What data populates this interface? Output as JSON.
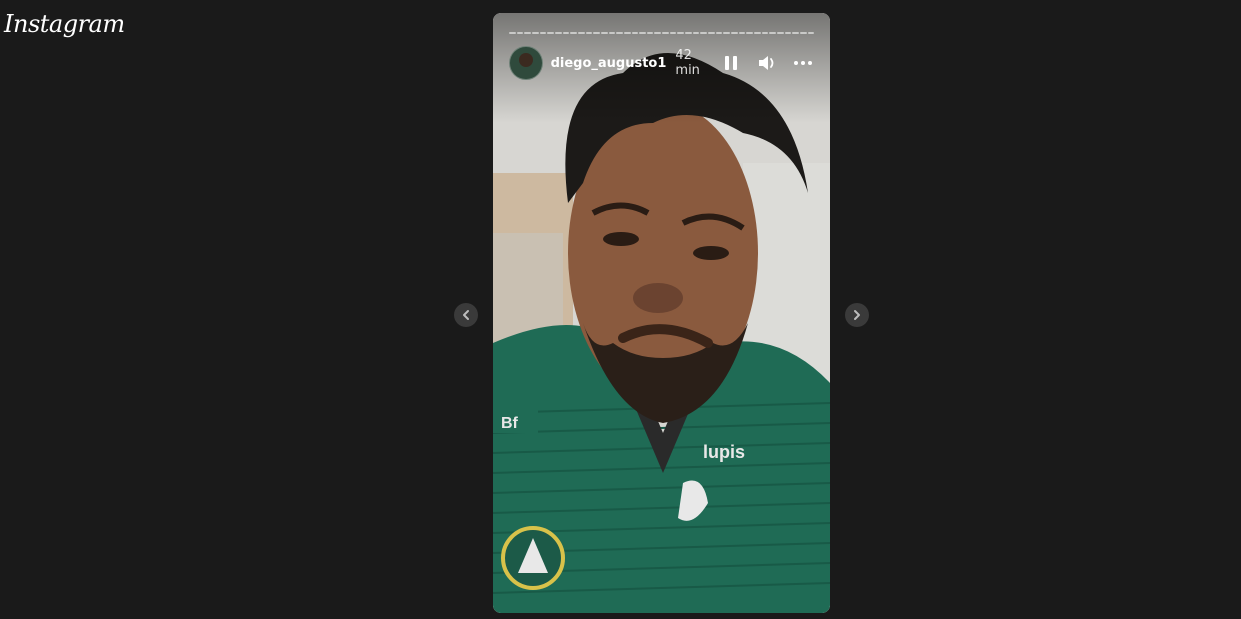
{
  "app": {
    "logo_text": "Instagram"
  },
  "story": {
    "username": "diego_augusto1",
    "time_ago": "42 min",
    "segments": 40
  },
  "icons": {
    "prev": "chevron-left-icon",
    "next": "chevron-right-icon",
    "pause": "pause-icon",
    "volume": "volume-icon",
    "more": "more-options-icon"
  },
  "colors": {
    "background": "#1a1a1a",
    "jersey": "#1f6b55"
  }
}
